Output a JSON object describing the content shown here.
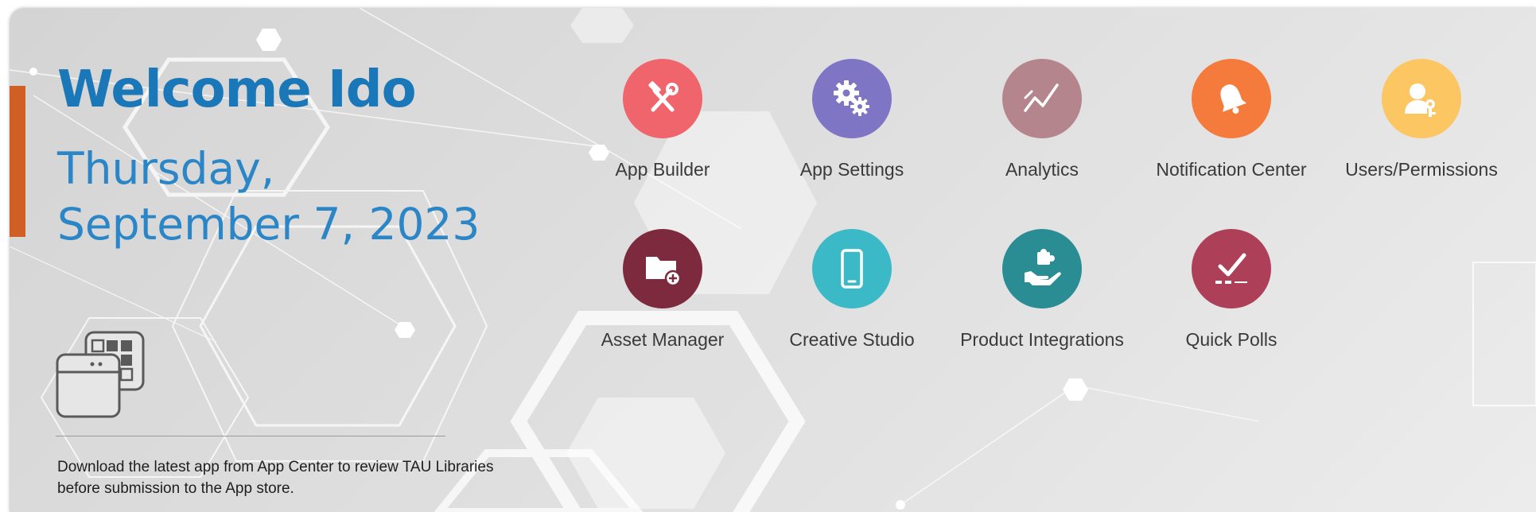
{
  "welcome": {
    "title": "Welcome Ido",
    "date_weekday": "Thursday,",
    "date_full": "September 7, 2023"
  },
  "download_notice": {
    "text": "Download the latest app from App Center to review TAU Libraries before submission to the App store."
  },
  "tiles": [
    {
      "label": "App Builder",
      "icon": "tools-icon",
      "color": "#f0646c"
    },
    {
      "label": "App Settings",
      "icon": "gears-icon",
      "color": "#7e75c4"
    },
    {
      "label": "Analytics",
      "icon": "analytics-icon",
      "color": "#b4858d"
    },
    {
      "label": "Notification Center",
      "icon": "bell-icon",
      "color": "#f47b3c"
    },
    {
      "label": "Users/Permissions",
      "icon": "user-key-icon",
      "color": "#fcc662"
    },
    {
      "label": "Asset Manager",
      "icon": "folder-add-icon",
      "color": "#7e2a3e"
    },
    {
      "label": "Creative Studio",
      "icon": "mobile-icon",
      "color": "#3bb9c7"
    },
    {
      "label": "Product Integrations",
      "icon": "puzzle-hand-icon",
      "color": "#2a8d94"
    },
    {
      "label": "Quick Polls",
      "icon": "check-poll-icon",
      "color": "#ad3f58"
    }
  ],
  "colors": {
    "accent": "#cf5f25",
    "title_blue": "#1a77b8",
    "date_blue": "#2a86c6"
  }
}
